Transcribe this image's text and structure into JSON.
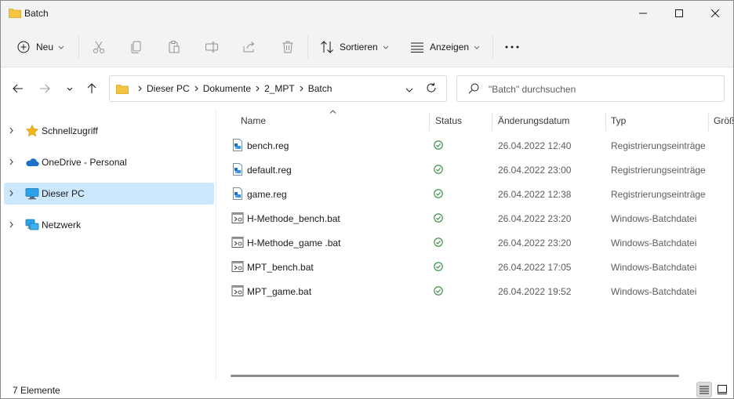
{
  "window": {
    "title": "Batch"
  },
  "commandbar": {
    "new_label": "Neu",
    "sort_label": "Sortieren",
    "view_label": "Anzeigen",
    "icons": [
      "cut-icon",
      "copy-icon",
      "paste-icon",
      "rename-icon",
      "share-icon",
      "delete-icon"
    ],
    "more_label": "⋯"
  },
  "address": {
    "crumbs": [
      "Dieser PC",
      "Dokumente",
      "2_MPT",
      "Batch"
    ],
    "search_placeholder": "\"Batch\" durchsuchen"
  },
  "nav": {
    "items": [
      {
        "label": "Schnellzugriff",
        "icon": "star-icon"
      },
      {
        "label": "OneDrive - Personal",
        "icon": "cloud-icon"
      },
      {
        "label": "Dieser PC",
        "icon": "pc-icon",
        "selected": true
      },
      {
        "label": "Netzwerk",
        "icon": "network-icon"
      }
    ]
  },
  "columns": {
    "name": "Name",
    "status": "Status",
    "date": "Änderungsdatum",
    "type": "Typ",
    "size": "Größ"
  },
  "files": [
    {
      "name": "bench.reg",
      "date": "26.04.2022 12:40",
      "type": "Registrierungseinträge",
      "kind": "reg"
    },
    {
      "name": "default.reg",
      "date": "26.04.2022 23:00",
      "type": "Registrierungseinträge",
      "kind": "reg"
    },
    {
      "name": "game.reg",
      "date": "26.04.2022 12:38",
      "type": "Registrierungseinträge",
      "kind": "reg"
    },
    {
      "name": "H-Methode_bench.bat",
      "date": "26.04.2022 23:20",
      "type": "Windows-Batchdatei",
      "kind": "bat"
    },
    {
      "name": "H-Methode_game .bat",
      "date": "26.04.2022 23:20",
      "type": "Windows-Batchdatei",
      "kind": "bat"
    },
    {
      "name": "MPT_bench.bat",
      "date": "26.04.2022 17:05",
      "type": "Windows-Batchdatei",
      "kind": "bat"
    },
    {
      "name": "MPT_game.bat",
      "date": "26.04.2022 19:52",
      "type": "Windows-Batchdatei",
      "kind": "bat"
    }
  ],
  "statusbar": {
    "count_text": "7 Elemente"
  },
  "colors": {
    "accent": "#0067c0",
    "selected_bg": "#cce8ff",
    "status_green": "#2e8b3a",
    "folder_yellow": "#f4c542"
  }
}
